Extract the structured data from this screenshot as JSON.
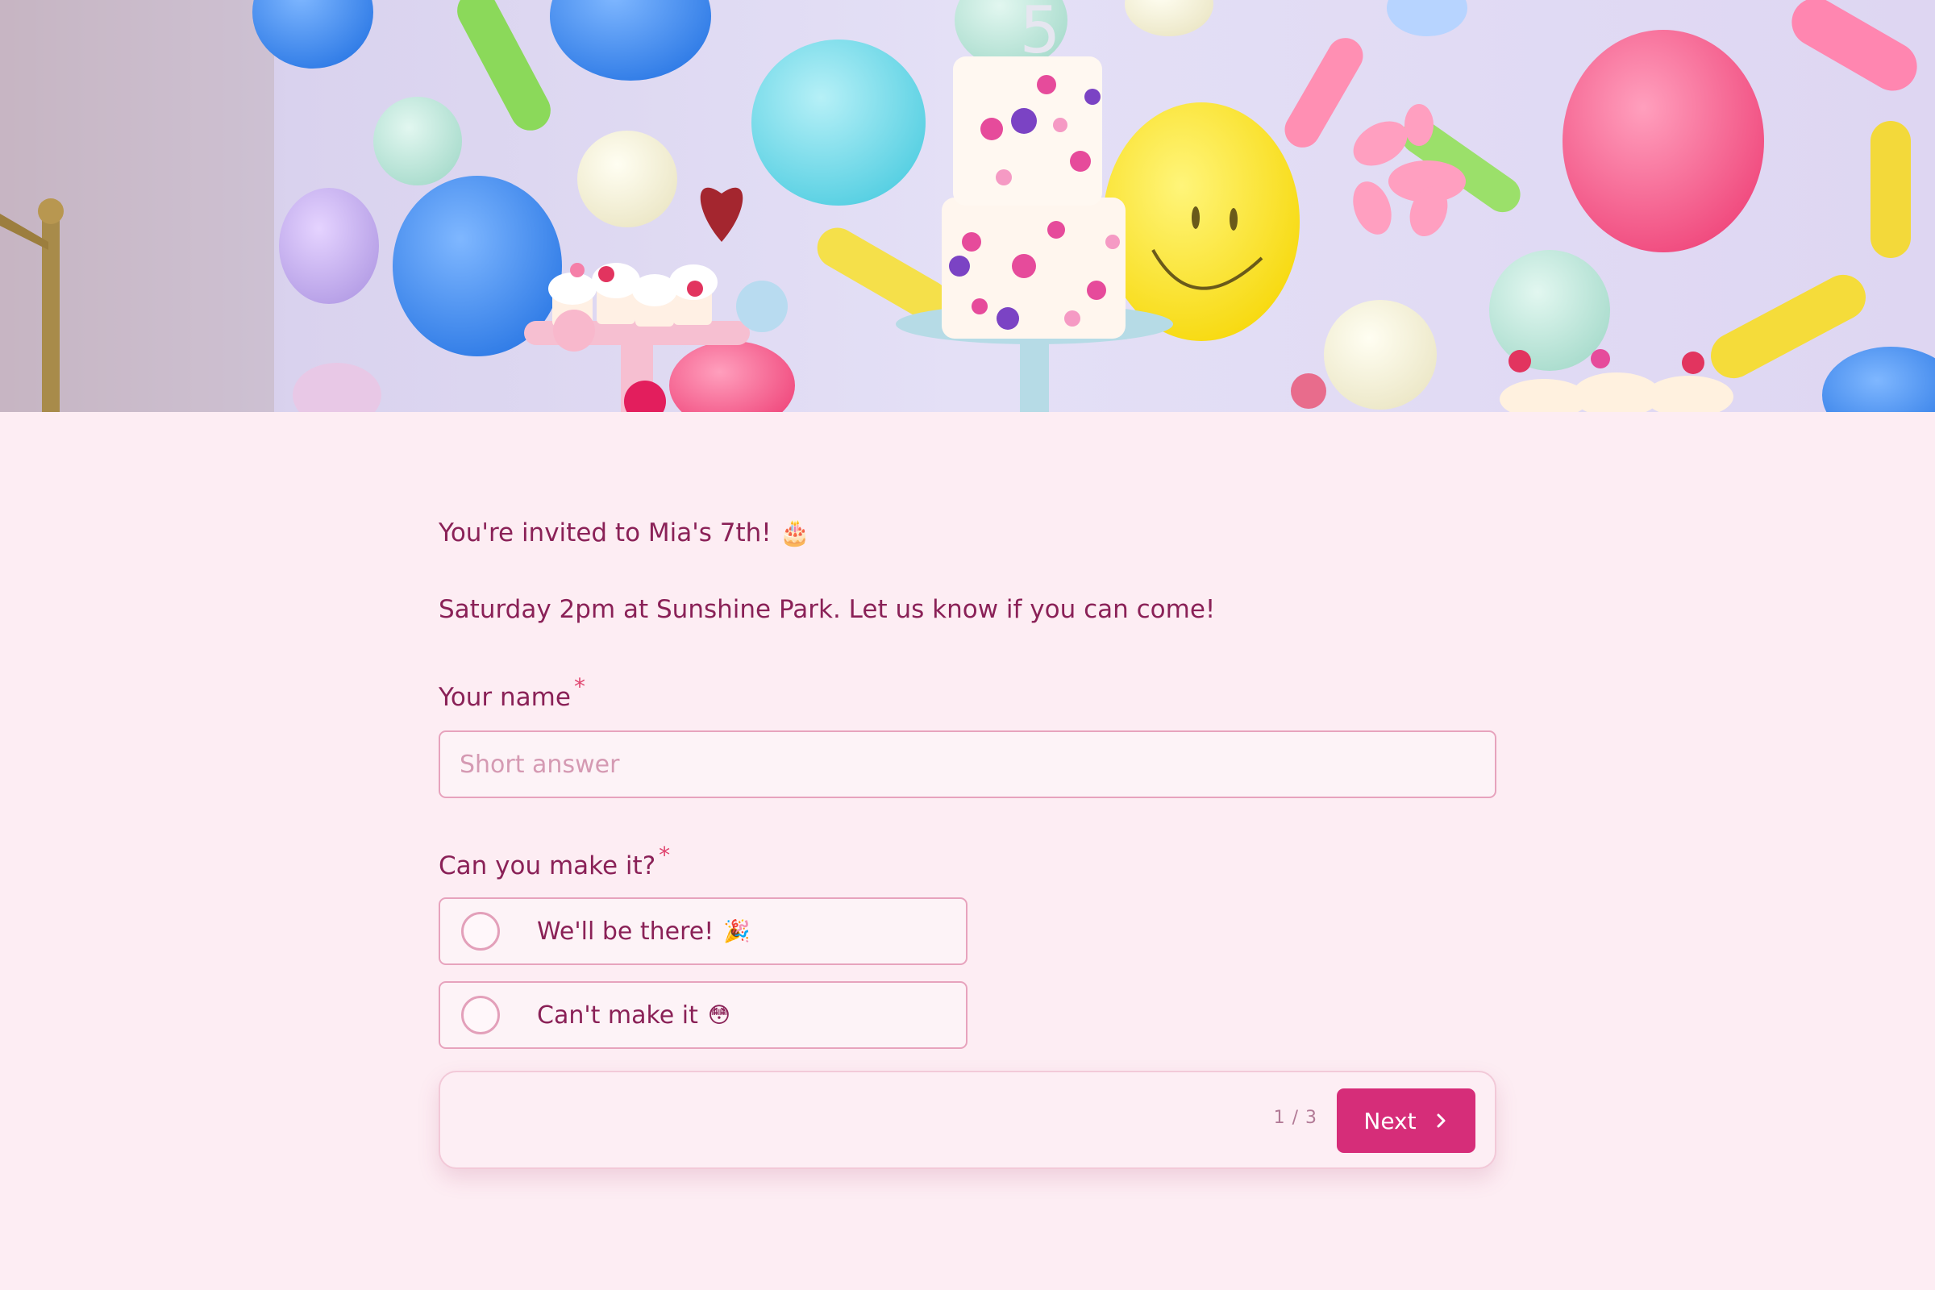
{
  "hero": {
    "image_icon": "birthday-party-banner-photo"
  },
  "form": {
    "headline": "You're invited to Mia's 7th!",
    "headline_emoji": "🎂",
    "subline": "Saturday 2pm at Sunshine Park. Let us know if you can come!",
    "questions": [
      {
        "label": "Your name",
        "required_mark": "*",
        "placeholder": "Short answer",
        "value": ""
      },
      {
        "label": "Can you make it?",
        "required_mark": "*",
        "options": [
          {
            "label": "We'll be there!",
            "emoji": "🎉",
            "selected": false
          },
          {
            "label": "Can't make it",
            "emoji": "😳",
            "selected": false
          }
        ]
      }
    ]
  },
  "nav": {
    "pager": "1 / 3",
    "next_label": "Next",
    "next_icon": "chevron-right-icon"
  },
  "colors": {
    "page_background": "#fdedf3",
    "text": "#8a2157",
    "accent": "#d62d79",
    "required": "#e0456f",
    "input_border": "#e7a3bd"
  }
}
